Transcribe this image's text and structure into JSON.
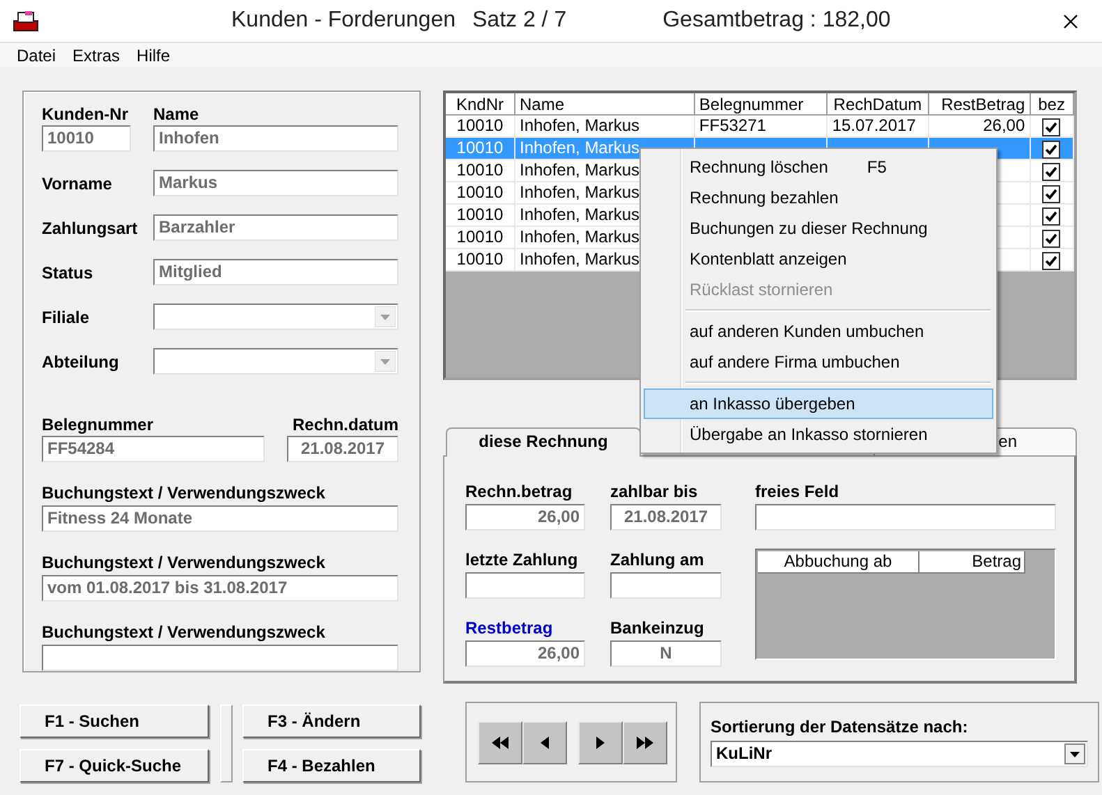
{
  "window": {
    "title": "Kunden - Forderungen",
    "record": "Satz 2 / 7",
    "total": "Gesamtbetrag : 182,00"
  },
  "menu": [
    "Datei",
    "Extras",
    "Hilfe"
  ],
  "customer": {
    "number": {
      "label": "Kunden-Nr",
      "value": "10010"
    },
    "name": {
      "label": "Name",
      "value": "Inhofen"
    },
    "rows": [
      {
        "label": "Vorname",
        "value": "Markus",
        "kind": "text"
      },
      {
        "label": "Zahlungsart",
        "value": "Barzahler",
        "kind": "text"
      },
      {
        "label": "Status",
        "value": "Mitglied",
        "kind": "text"
      },
      {
        "label": "Filiale",
        "kind": "combo"
      },
      {
        "label": "Abteilung",
        "kind": "combo"
      }
    ]
  },
  "invoice": {
    "number": {
      "label": "Belegnummer",
      "value": "FF54284"
    },
    "date": {
      "label": "Rechn.datum",
      "value": "21.08.2017"
    },
    "texts": [
      {
        "label": "Buchungstext / Verwendungszweck",
        "value": "Fitness 24 Monate"
      },
      {
        "label": "Buchungstext / Verwendungszweck",
        "value": "vom 01.08.2017 bis 31.08.2017"
      },
      {
        "label": "Buchungstext / Verwendungszweck"
      }
    ]
  },
  "table": {
    "columns": [
      "KndNr",
      "Name",
      "Belegnummer",
      "RechDatum",
      "RestBetrag",
      "bez"
    ],
    "rows": [
      {
        "cells": [
          "10010",
          "Inhofen, Markus",
          "FF53271",
          "15.07.2017",
          "26,00"
        ],
        "paid": true,
        "selected": false
      },
      {
        "cells": [
          "10010",
          "Inhofen, Markus"
        ],
        "paid": true,
        "selected": true
      },
      {
        "cells": [
          "10010",
          "Inhofen, Markus"
        ],
        "paid": true,
        "selected": false
      },
      {
        "cells": [
          "10010",
          "Inhofen, Markus"
        ],
        "paid": true,
        "selected": false
      },
      {
        "cells": [
          "10010",
          "Inhofen, Markus"
        ],
        "paid": true,
        "selected": false
      },
      {
        "cells": [
          "10010",
          "Inhofen, Markus"
        ],
        "paid": true,
        "selected": false
      },
      {
        "cells": [
          "10010",
          "Inhofen, Markus"
        ],
        "paid": true,
        "selected": false
      }
    ]
  },
  "context_menu": {
    "items": [
      {
        "kind": "item",
        "label": "Rechnung löschen",
        "shortcut": "F5",
        "disabled": false,
        "selected": false
      },
      {
        "kind": "item",
        "label": "Rechnung bezahlen",
        "disabled": false,
        "selected": false
      },
      {
        "kind": "item",
        "label": "Buchungen zu dieser Rechnung",
        "disabled": false,
        "selected": false
      },
      {
        "kind": "item",
        "label": "Kontenblatt anzeigen",
        "disabled": false,
        "selected": false
      },
      {
        "kind": "item",
        "label": "Rücklast stornieren",
        "disabled": true,
        "selected": false
      },
      {
        "kind": "separator"
      },
      {
        "kind": "item",
        "label": "auf anderen Kunden umbuchen",
        "disabled": false,
        "selected": false
      },
      {
        "kind": "item",
        "label": "auf andere Firma umbuchen",
        "disabled": false,
        "selected": false
      },
      {
        "kind": "separator"
      },
      {
        "kind": "item",
        "label": "an Inkasso übergeben",
        "disabled": false,
        "selected": true
      },
      {
        "kind": "item",
        "label": "Übergabe an Inkasso stornieren",
        "disabled": false,
        "selected": false
      }
    ]
  },
  "tabs": [
    {
      "label": "diese Rechnung",
      "selected": true
    },
    {
      "label": "en",
      "selected": false
    }
  ],
  "details": {
    "fields": [
      {
        "label": "Rechn.betrag",
        "value": "26,00",
        "kind": "amount",
        "highlight": false
      },
      {
        "label": "zahlbar bis",
        "value": "21.08.2017",
        "kind": "date",
        "highlight": false
      },
      {
        "label": "letzte Zahlung",
        "kind": "amount",
        "highlight": false
      },
      {
        "label": "Zahlung am",
        "kind": "date",
        "highlight": false
      },
      {
        "label": "Restbetrag",
        "value": "26,00",
        "kind": "amount",
        "highlight": true
      },
      {
        "label": "Bankeinzug",
        "value": "N",
        "kind": "flag",
        "highlight": false
      }
    ],
    "free_field": {
      "label": "freies Feld"
    },
    "bookings": {
      "columns": [
        "Abbuchung ab",
        "Betrag"
      ]
    }
  },
  "buttons": [
    "F1 - Suchen",
    "F3 - Ändern",
    "F7 - Quick-Suche",
    "F4 - Bezahlen"
  ],
  "sorting": {
    "label": "Sortierung der Datensätze nach:",
    "value": "KuLiNr"
  }
}
